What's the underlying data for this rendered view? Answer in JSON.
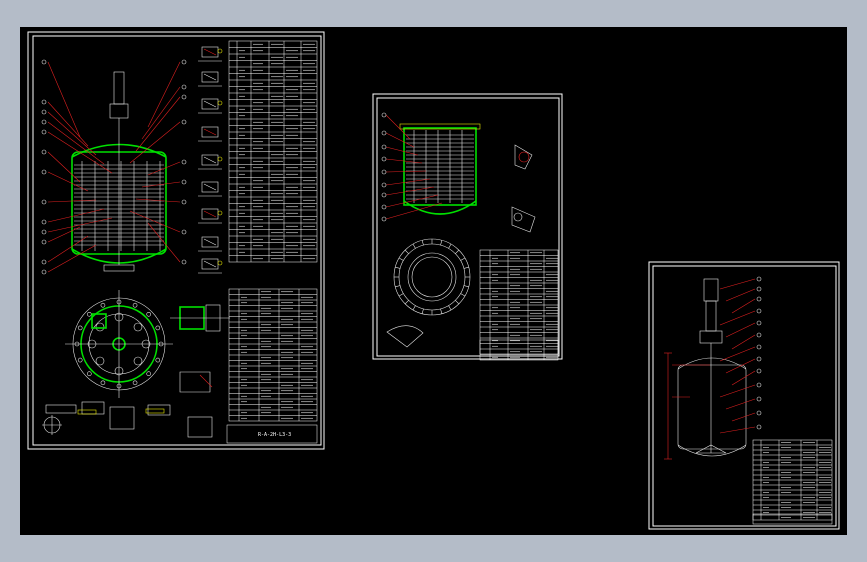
{
  "sheets": [
    {
      "id": "main-assembly",
      "title_block": "R-A-2H-L3-3"
    },
    {
      "id": "jacket-detail",
      "title_block": ""
    },
    {
      "id": "layout",
      "title_block": ""
    }
  ],
  "colors": {
    "background": "#000000",
    "line": "#ffffff",
    "vessel_outline": "#00e000",
    "leader": "#e02020",
    "dimension": "#e8e800"
  }
}
